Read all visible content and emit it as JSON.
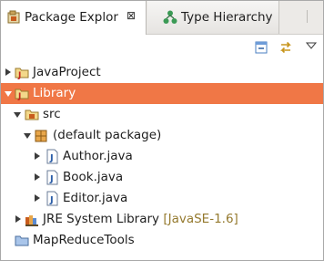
{
  "tabs": [
    {
      "label": "Package Explor",
      "active": true
    },
    {
      "label": "Type Hierarchy",
      "active": false
    }
  ],
  "toolbar": {
    "buttons": [
      "collapse-all-icon",
      "link-with-editor-icon",
      "view-menu-icon"
    ]
  },
  "tree": [
    {
      "label": "JavaProject",
      "level": 0,
      "expanded": false,
      "icon": "java-project-icon"
    },
    {
      "label": "Library",
      "level": 0,
      "expanded": true,
      "selected": true,
      "icon": "java-project-icon"
    },
    {
      "label": "src",
      "level": 1,
      "expanded": true,
      "icon": "source-folder-icon"
    },
    {
      "label": "(default package)",
      "level": 2,
      "expanded": true,
      "icon": "package-icon"
    },
    {
      "label": "Author.java",
      "level": 3,
      "expanded": false,
      "icon": "java-file-icon"
    },
    {
      "label": "Book.java",
      "level": 3,
      "expanded": false,
      "icon": "java-file-icon"
    },
    {
      "label": "Editor.java",
      "level": 3,
      "expanded": false,
      "icon": "java-file-icon"
    },
    {
      "label": "JRE System Library",
      "decoration": "[JavaSE-1.6]",
      "level": 1,
      "expanded": false,
      "icon": "library-icon"
    },
    {
      "label": "MapReduceTools",
      "level": 0,
      "icon": "folder-icon"
    }
  ],
  "colors": {
    "selection": "#f07746",
    "decoration_text": "#957a2f"
  }
}
